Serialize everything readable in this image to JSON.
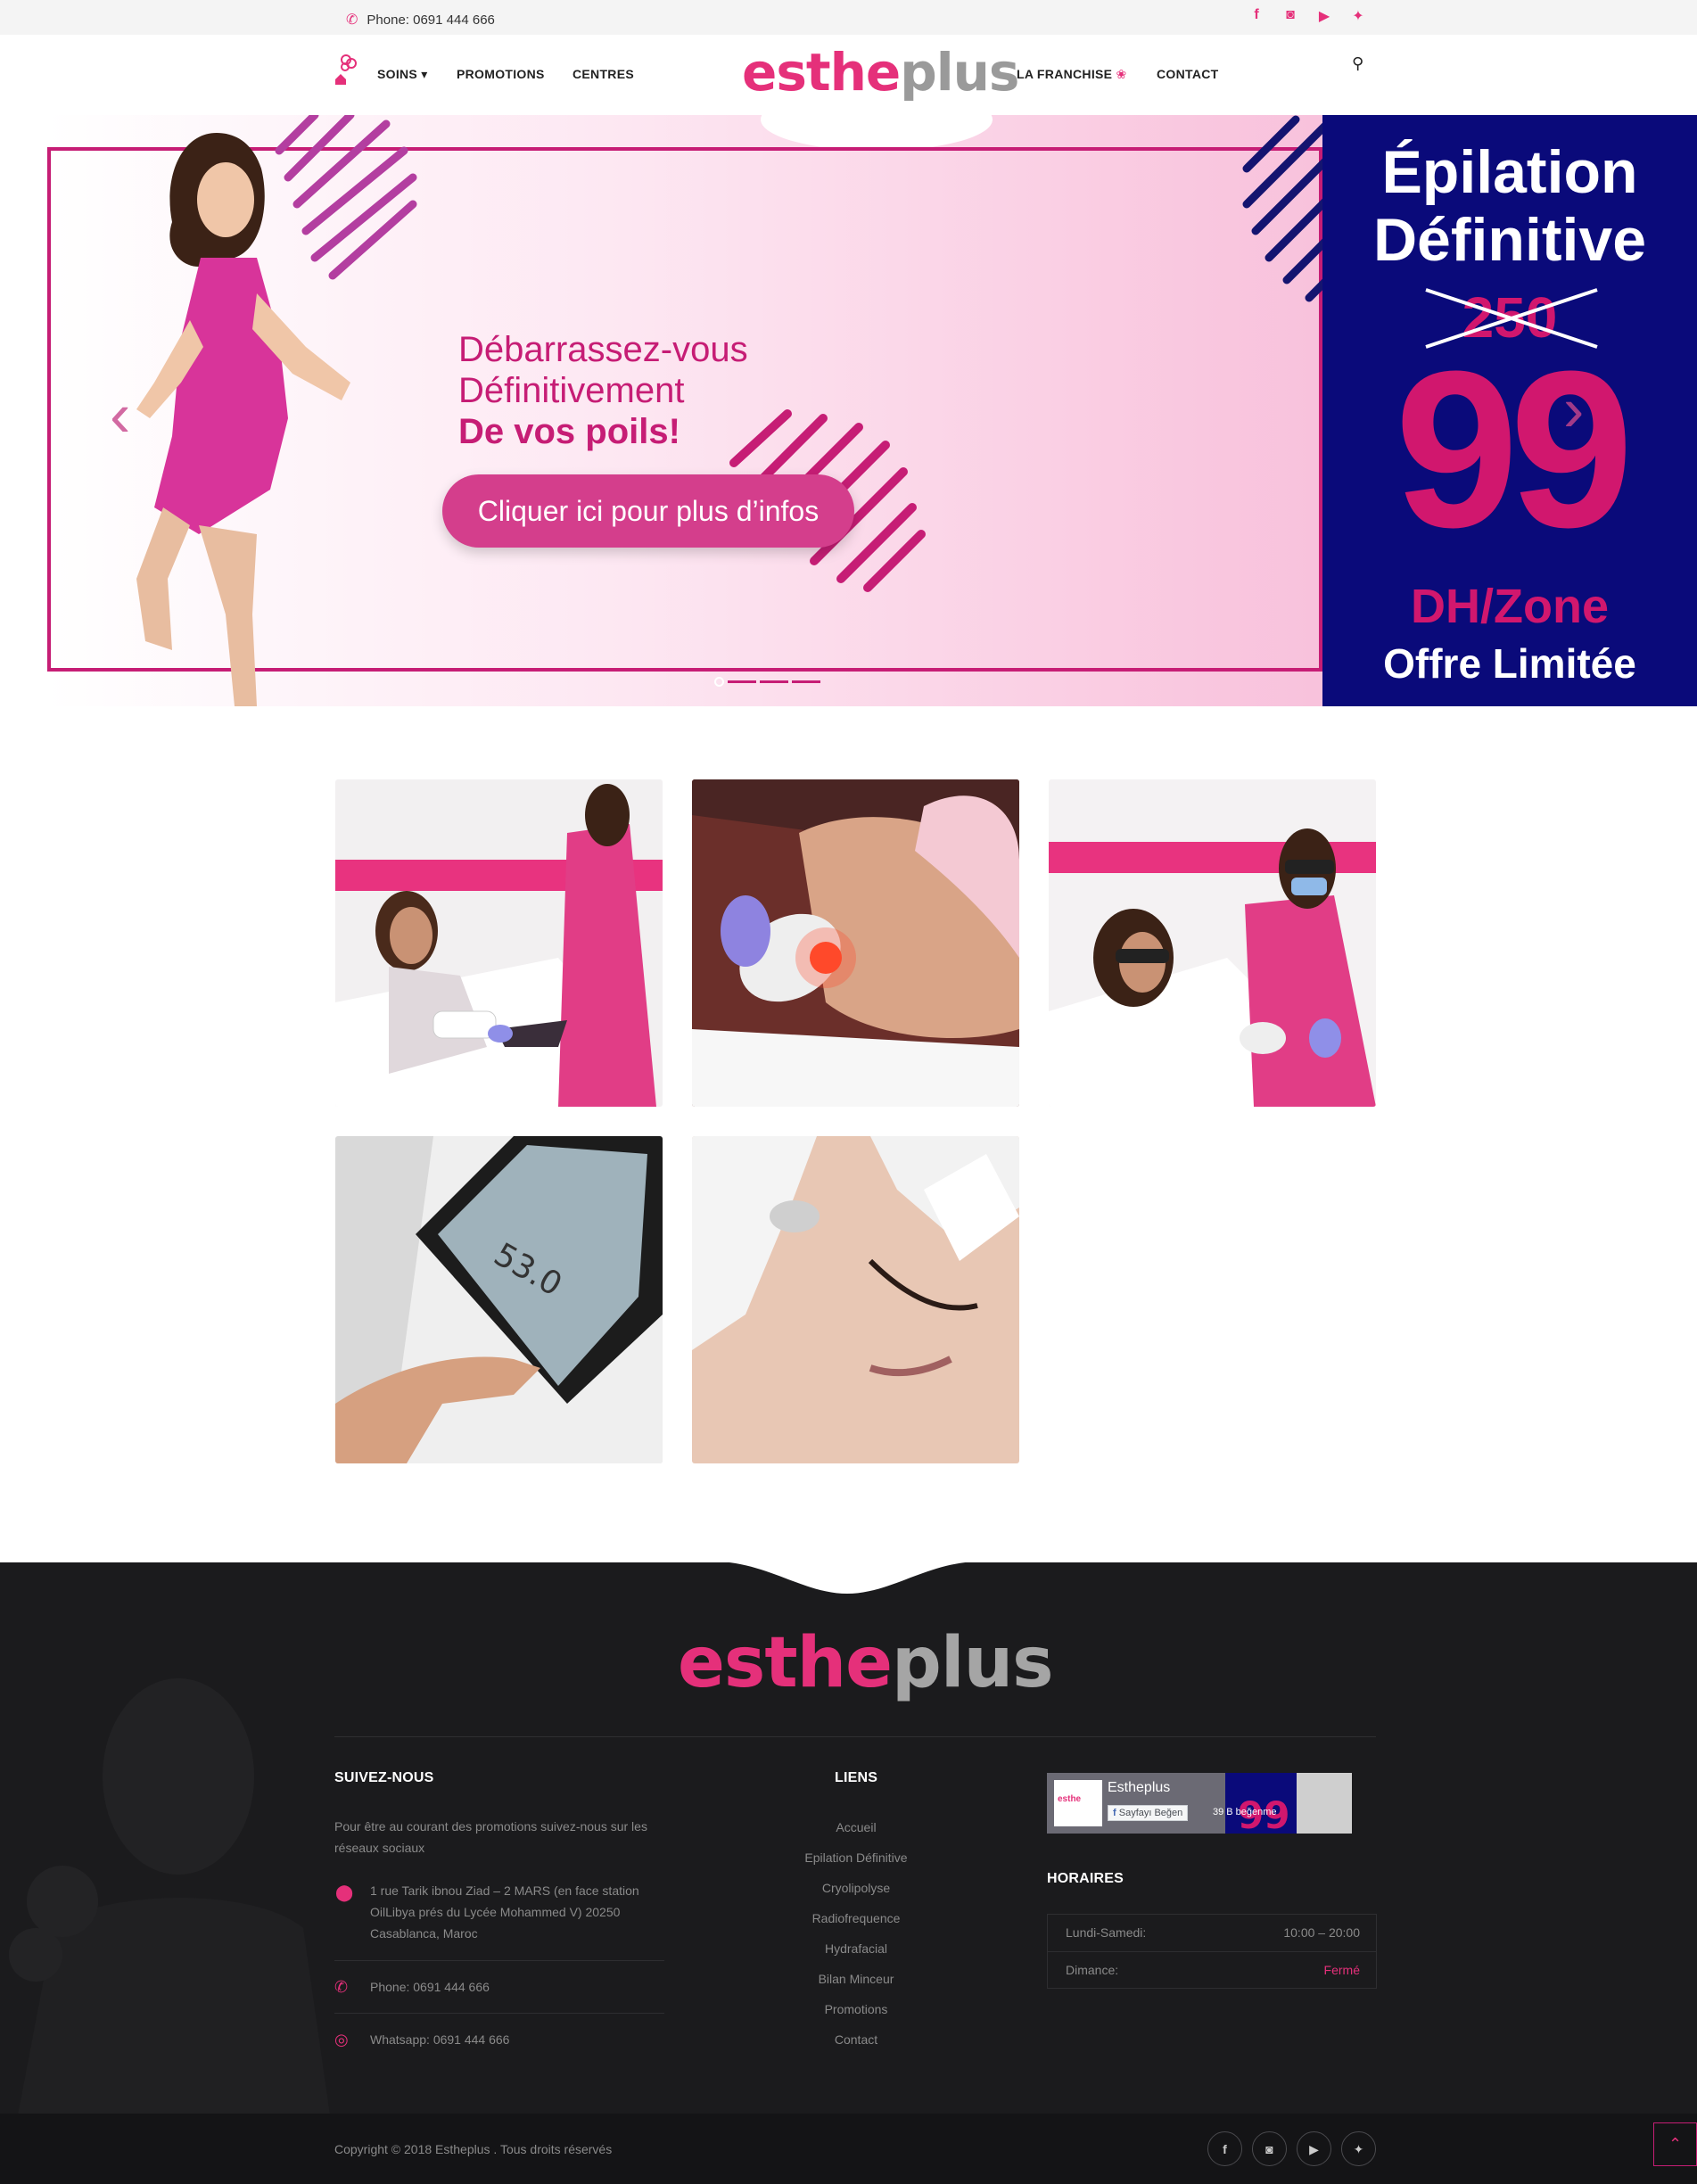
{
  "topbar": {
    "phone": "Phone: 0691 444 666",
    "social": [
      "facebook-icon",
      "instagram-icon",
      "youtube-icon",
      "twitter-icon"
    ]
  },
  "nav": {
    "soins": "SOINS",
    "promotions": "PROMOTIONS",
    "centres": "CENTRES",
    "franchise": "LA FRANCHISE",
    "contact": "CONTACT"
  },
  "logo": {
    "part1": "esthe",
    "part2": "plus"
  },
  "hero": {
    "line1": "Débarrassez-vous",
    "line2": "Définitivement",
    "line3": "De vos poils!",
    "cta": "Cliquer ici pour plus d’infos",
    "prev": "‹",
    "next": "›"
  },
  "promo": {
    "title1": "Épilation",
    "title2": "Définitive",
    "old_price": "250",
    "price": "99",
    "unit": "DH/Zone",
    "limited": "Offre Limitée",
    "colors": {
      "bg": "#0a0a7a",
      "accent": "#d1176e"
    }
  },
  "gallery": {
    "count": 5,
    "screen_value": "53.0"
  },
  "footer": {
    "follow_title": "SUIVEZ-NOUS",
    "follow_text": "Pour être au courant des promotions suivez-nous sur les réseaux sociaux",
    "address": "1 rue Tarik ibnou Ziad – 2 MARS (en face station OilLibya prés du Lycée Mohammed V) 20250 Casablanca, Maroc",
    "phone": "Phone: 0691 444 666",
    "whatsapp": "Whatsapp: 0691 444 666",
    "links_title": "LIENS",
    "links": [
      "Accueil",
      "Epilation Définitive",
      "Cryolipolyse",
      "Radiofrequence",
      "Hydrafacial",
      "Bilan Minceur",
      "Promotions",
      "Contact"
    ],
    "fb": {
      "page": "Estheplus",
      "like": "Sayfayı Beğen",
      "likes": "39 B beğenme"
    },
    "hours_title": "HORAIRES",
    "hours": [
      {
        "day": "Lundi-Samedi:",
        "time": "10:00 – 20:00"
      },
      {
        "day": "Dimance:",
        "time": "Fermé"
      }
    ],
    "copyright": "Copyright © 2018 Estheplus . Tous droits réservés"
  },
  "accent": "#e5307a"
}
